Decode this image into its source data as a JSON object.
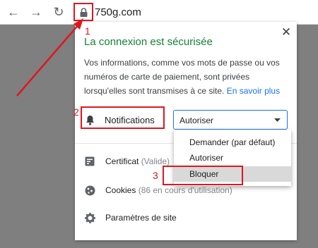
{
  "browser": {
    "back_icon": "arrow-left",
    "forward_icon": "arrow-right",
    "reload_icon": "reload",
    "url": "750g.com"
  },
  "site_info": {
    "title": "La connexion est sécurisée",
    "description": "Vos informations, comme vos mots de passe ou vos numéros de carte de paiement, sont privées lorsqu'elles sont transmises à ce site.",
    "learn_more_link": "En savoir plus",
    "notifications_label": "Notifications",
    "notifications_value": "Autoriser",
    "notification_options": [
      "Demander (par défaut)",
      "Autoriser",
      "Bloquer"
    ],
    "selected_option_index": 2,
    "certificate_label": "Certificat",
    "certificate_status": "(Valide)",
    "cookies_label": "Cookies",
    "cookies_status": "(86 en cours d'utilisation)",
    "site_settings_label": "Paramètres de site"
  },
  "annotations": {
    "step1": "1",
    "step2": "2",
    "step3": "3",
    "color": "#e0161f"
  },
  "colors": {
    "secure_green": "#188038",
    "link_blue": "#1a73e8",
    "backdrop": "#7f7f7f"
  }
}
